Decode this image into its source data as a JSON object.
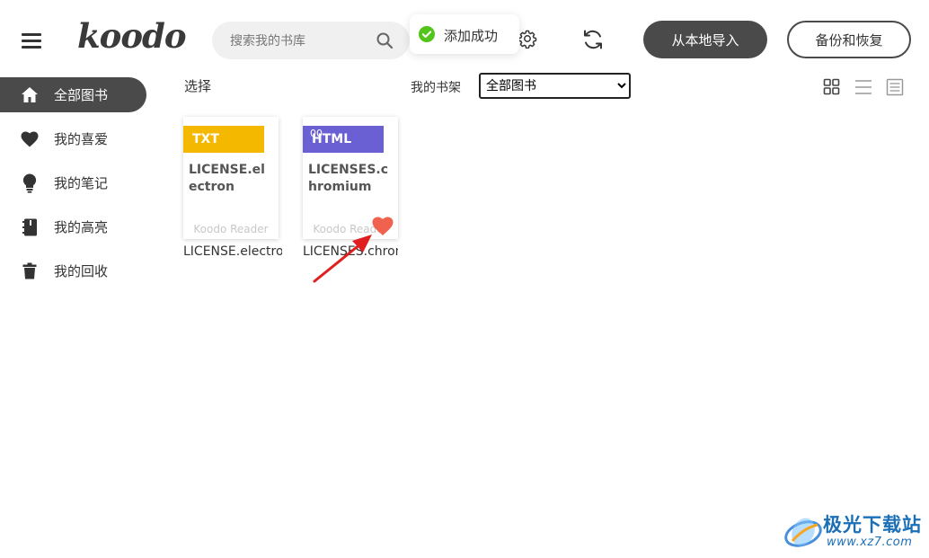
{
  "header": {
    "logo_text": "koodo",
    "search_placeholder": "搜索我的书库",
    "toast_text": "添加成功",
    "import_button": "从本地导入",
    "backup_button": "备份和恢复"
  },
  "sidebar": {
    "items": [
      {
        "label": "全部图书",
        "icon": "home-icon",
        "active": true
      },
      {
        "label": "我的喜爱",
        "icon": "heart-icon",
        "active": false
      },
      {
        "label": "我的笔记",
        "icon": "lightbulb-icon",
        "active": false
      },
      {
        "label": "我的高亮",
        "icon": "notebook-icon",
        "active": false
      },
      {
        "label": "我的回收",
        "icon": "trash-icon",
        "active": false
      }
    ]
  },
  "toolbar": {
    "select_label": "选择",
    "shelf_label": "我的书架",
    "shelf_selected": "全部图书"
  },
  "books": [
    {
      "format": "TXT",
      "format_color": "#f5b800",
      "cover_title": "LICENSE.electron",
      "publisher": "Koodo Reader",
      "name": "LICENSE.electron"
    },
    {
      "format": "HTML",
      "format_color": "#6a5fd3",
      "cover_title": "LICENSES.chromium",
      "publisher": "Koodo Reader",
      "name": "LICENSES.chromium",
      "percent": "00",
      "favorite": true
    }
  ],
  "watermark": {
    "name": "极光下载站",
    "url": "www.xz7.com"
  },
  "colors": {
    "dark": "#4a4a4a",
    "heart": "#f0624d",
    "toast_ok": "#52c41a",
    "annotation_arrow": "#e02020"
  }
}
